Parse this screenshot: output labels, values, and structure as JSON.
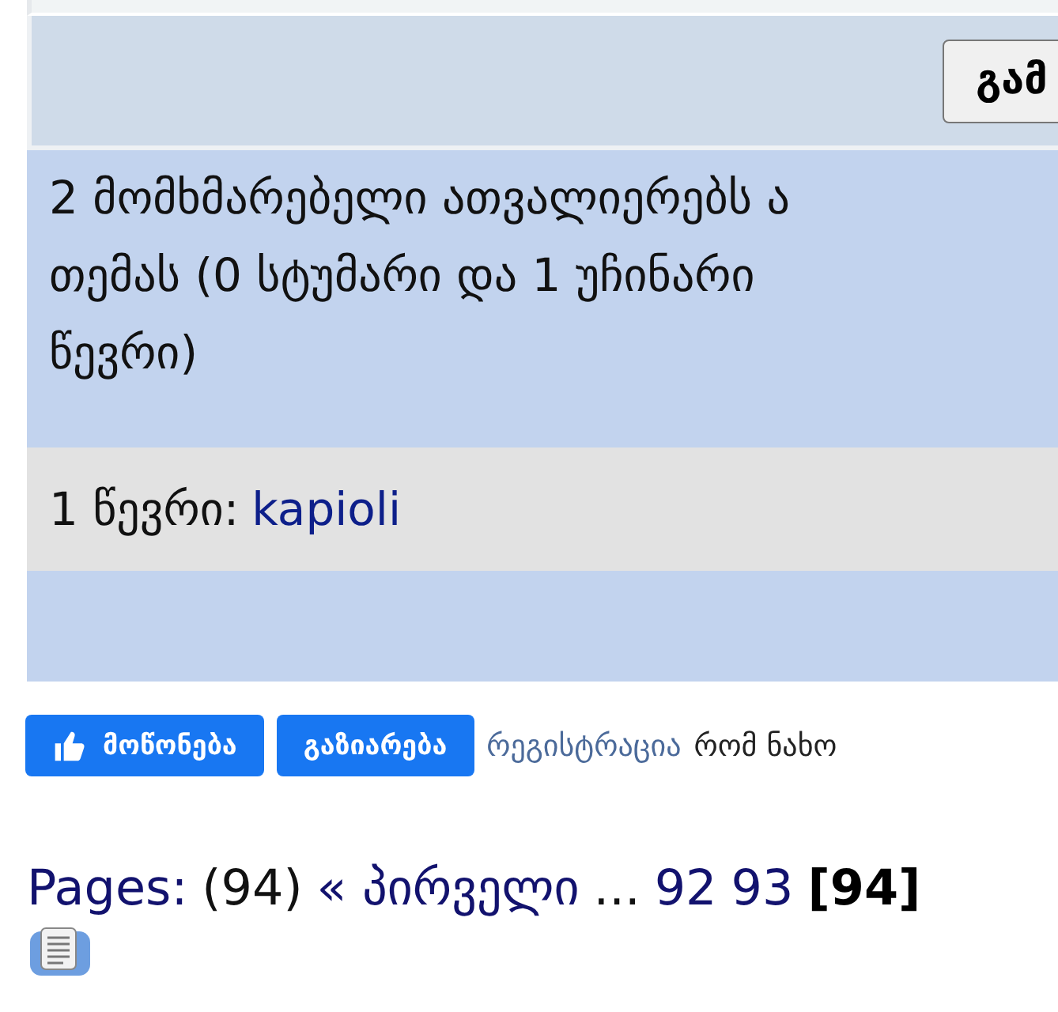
{
  "form_button": "გამ",
  "online": {
    "lines": [
      "2 მომხმარებელი ათვალიერებს ა",
      "თემას (0 სტუმარი და 1 უჩინარი",
      "წევრი)"
    ]
  },
  "members": {
    "label": "1 წევრი:",
    "names": [
      "kapioli"
    ]
  },
  "like_button": "მოწონება",
  "share_button": "გაზიარება",
  "register": {
    "link": "რეგისტრაცია",
    "text": "რომ ნახო"
  },
  "pages": {
    "label": "Pages:",
    "count": "(94)",
    "first": "« პირველი",
    "ellipsis": "...",
    "links": [
      "92",
      "93"
    ],
    "current": "[94]"
  }
}
